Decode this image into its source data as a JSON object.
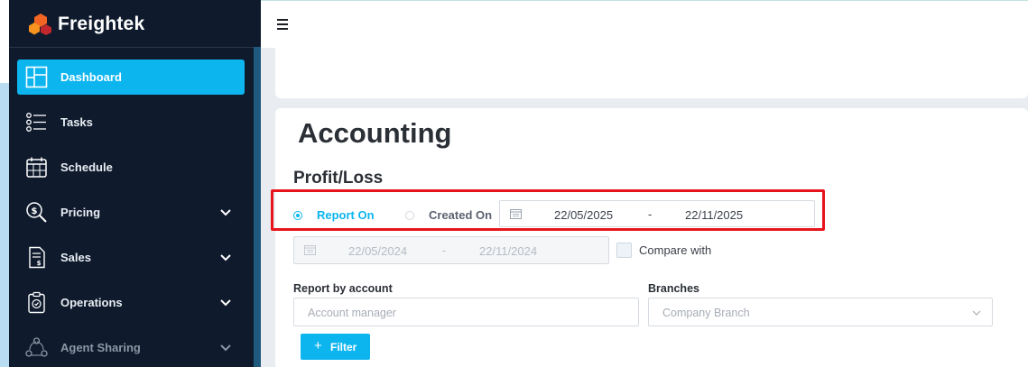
{
  "app": {
    "name": "Freightek"
  },
  "sidebar": {
    "items": [
      {
        "label": "Dashboard",
        "icon": "dashboard-icon",
        "active": true,
        "expandable": false
      },
      {
        "label": "Tasks",
        "icon": "tasks-icon",
        "active": false,
        "expandable": false
      },
      {
        "label": "Schedule",
        "icon": "calendar-icon",
        "active": false,
        "expandable": false
      },
      {
        "label": "Pricing",
        "icon": "pricing-search-icon",
        "active": false,
        "expandable": true
      },
      {
        "label": "Sales",
        "icon": "invoice-icon",
        "active": false,
        "expandable": true
      },
      {
        "label": "Operations",
        "icon": "clipboard-icon",
        "active": false,
        "expandable": true
      },
      {
        "label": "Agent Sharing",
        "icon": "agent-sharing-icon",
        "active": false,
        "expandable": true
      }
    ]
  },
  "page": {
    "title": "Accounting",
    "section": "Profit/Loss"
  },
  "report_mode": {
    "options": [
      "Report On",
      "Created On"
    ],
    "selected": "Report On"
  },
  "date_range": {
    "from": "22/05/2025",
    "separator": "-",
    "to": "22/11/2025"
  },
  "compare_range": {
    "from": "22/05/2024",
    "separator": "-",
    "to": "22/11/2024"
  },
  "compare": {
    "label": "Compare with",
    "checked": false
  },
  "report_by_account": {
    "label": "Report by account",
    "placeholder": "Account manager"
  },
  "branches": {
    "label": "Branches",
    "placeholder": "Company Branch"
  },
  "filter_button": {
    "label": "Filter"
  },
  "colors": {
    "accent": "#0db5ef",
    "sidebar_bg": "#0f1b2d",
    "highlight": "#e8141c"
  }
}
